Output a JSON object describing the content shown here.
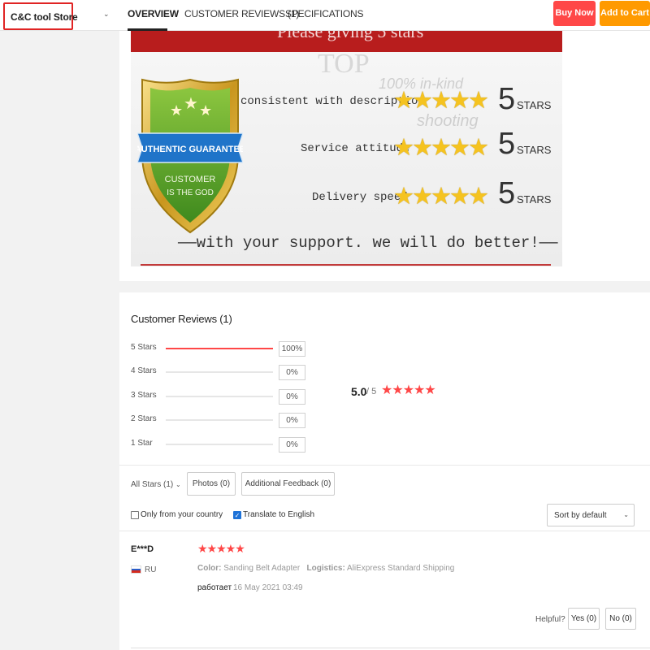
{
  "header": {
    "store_name": "C&C tool Store",
    "tabs": [
      "OVERVIEW",
      "CUSTOMER REVIEWS (1)",
      "SPECIFICATIONS"
    ],
    "buy_now": "Buy Now",
    "add_to_cart": "Add to Cart"
  },
  "banner": {
    "top_text": "Please giving 5 stars",
    "watermark_main": "TOP",
    "watermark_line1": "100% in-kind",
    "watermark_line2": "shooting",
    "badge_ribbon": "AUTHENTIC GUARANTEE",
    "badge_line1": "CUSTOMER",
    "badge_line2": "IS THE GOD",
    "ratings": [
      {
        "label": "consistent with description",
        "stars": "★★★★★",
        "num": "5",
        "suffix": "STARS"
      },
      {
        "label": "Service attitude",
        "stars": "★★★★★",
        "num": "5",
        "suffix": "STARS"
      },
      {
        "label": "Delivery speed",
        "stars": "★★★★★",
        "num": "5",
        "suffix": "STARS"
      }
    ],
    "support_text": "——with your support. we will do better!——"
  },
  "reviews": {
    "title": "Customer Reviews (1)",
    "distribution": [
      {
        "label": "5 Stars",
        "percent": "100%",
        "fraction": 1.0
      },
      {
        "label": "4 Stars",
        "percent": "0%",
        "fraction": 0
      },
      {
        "label": "3 Stars",
        "percent": "0%",
        "fraction": 0
      },
      {
        "label": "2 Stars",
        "percent": "0%",
        "fraction": 0
      },
      {
        "label": "1 Star",
        "percent": "0%",
        "fraction": 0
      }
    ],
    "average_score": "5.0",
    "average_suffix": "/ 5",
    "average_stars": "★★★★★",
    "accent_color": "#ff4747",
    "filters": {
      "all_stars": "All Stars (1)",
      "photos": "Photos (0)",
      "additional_feedback": "Additional Feedback (0)",
      "only_your_country": "Only from your country",
      "only_your_country_checked": false,
      "translate": "Translate to English",
      "translate_checked": true,
      "sort_by": "Sort by default"
    },
    "items": [
      {
        "reviewer": "E***D",
        "country": "RU",
        "stars": "★★★★★",
        "color_label": "Color:",
        "color_value": "Sanding Belt Adapter",
        "logistics_label": "Logistics:",
        "logistics_value": "AliExpress Standard Shipping",
        "text": "работает",
        "date": "16 May 2021 03:49",
        "helpful_label": "Helpful?",
        "yes_label": "Yes (0)",
        "no_label": "No (0)"
      }
    ]
  }
}
